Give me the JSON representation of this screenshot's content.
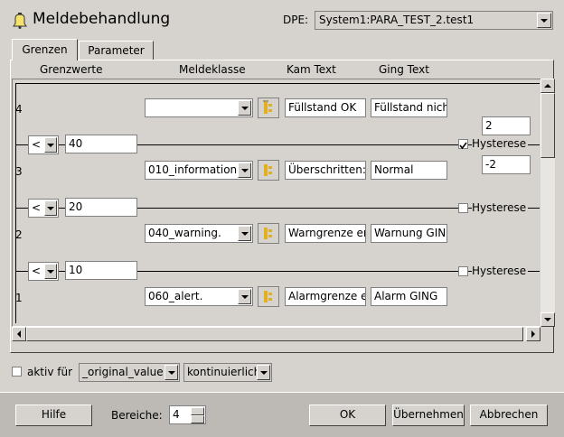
{
  "header": {
    "title": "Meldebehandlung",
    "dpe_label": "DPE:",
    "dpe_value": "System1:PARA_TEST_2.test1"
  },
  "tabs": [
    {
      "label": "Grenzen",
      "active": true
    },
    {
      "label": "Parameter",
      "active": false
    }
  ],
  "columns": {
    "grenzwerte": "Grenzwerte",
    "meldeklasse": "Meldeklasse",
    "kam_text": "Kam Text",
    "ging_text": "Ging Text"
  },
  "ranges": [
    {
      "index": "4",
      "meldeklasse": "",
      "kam": "Füllstand OK",
      "ging": "Füllstand nich"
    },
    {
      "index": "3",
      "meldeklasse": "010_information.",
      "kam": "Überschritten:",
      "ging": "Normal"
    },
    {
      "index": "2",
      "meldeklasse": "040_warning.",
      "kam": "Warngrenze er",
      "ging": "Warnung GING"
    },
    {
      "index": "1",
      "meldeklasse": "060_alert.",
      "kam": "Alarmgrenze e",
      "ging": "Alarm GING"
    }
  ],
  "limits": [
    {
      "operator": "<",
      "value": "40",
      "hysterese_label": "Hysterese",
      "hysterese_checked": true,
      "hyst_upper": "2",
      "hyst_lower": "-2"
    },
    {
      "operator": "<",
      "value": "20",
      "hysterese_label": "Hysterese",
      "hysterese_checked": false
    },
    {
      "operator": "<",
      "value": "10",
      "hysterese_label": "Hysterese",
      "hysterese_checked": false
    }
  ],
  "bottom_options": {
    "aktiv_label": "aktiv für",
    "aktiv_checked": false,
    "value_select": "_original_value",
    "mode_select": "kontinuierlich"
  },
  "footer": {
    "help": "Hilfe",
    "bereiche_label": "Bereiche:",
    "bereiche_value": "4",
    "ok": "OK",
    "apply": "Übernehmen",
    "cancel": "Abbrechen"
  }
}
